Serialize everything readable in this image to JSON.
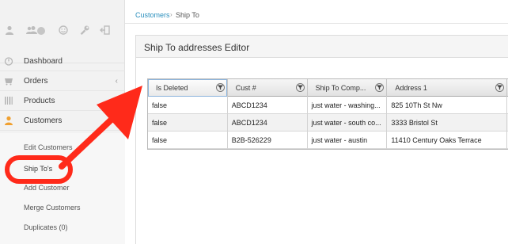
{
  "colors": {
    "accent": "#2a8fbd",
    "annotation": "#ff2a1a",
    "active_icon": "#f0a030"
  },
  "sidebar": {
    "top_icons": [
      "user-icon",
      "users-icon",
      "smiley-icon",
      "wrench-icon",
      "logout-icon"
    ],
    "top_badge": "",
    "items": [
      {
        "label": "Dashboard",
        "icon": "dashboard-icon",
        "has_chevron": false
      },
      {
        "label": "Orders",
        "icon": "orders-icon",
        "has_chevron": true
      },
      {
        "label": "Products",
        "icon": "products-icon",
        "has_chevron": true
      },
      {
        "label": "Customers",
        "icon": "customers-icon",
        "has_chevron": false,
        "active": true
      }
    ],
    "chevron": "‹",
    "submenu": [
      "Edit Customers",
      "Ship To's",
      "Add Customer",
      "Merge Customers",
      "Duplicates (0)"
    ]
  },
  "breadcrumb": {
    "parent": "Customers",
    "separator": "›",
    "current": "Ship To"
  },
  "panel": {
    "title": "Ship To addresses Editor"
  },
  "grid": {
    "columns": [
      "Is Deleted",
      "Cust #",
      "Ship To Comp...",
      "Address 1"
    ],
    "rows": [
      [
        "false",
        "ABCD1234",
        "just water - washing...",
        "825 10Th St Nw"
      ],
      [
        "false",
        "ABCD1234",
        "just water - south co...",
        "3333 Bristol St"
      ],
      [
        "false",
        "B2B-526229",
        "just water - austin",
        "11410 Century Oaks Terrace"
      ]
    ]
  }
}
